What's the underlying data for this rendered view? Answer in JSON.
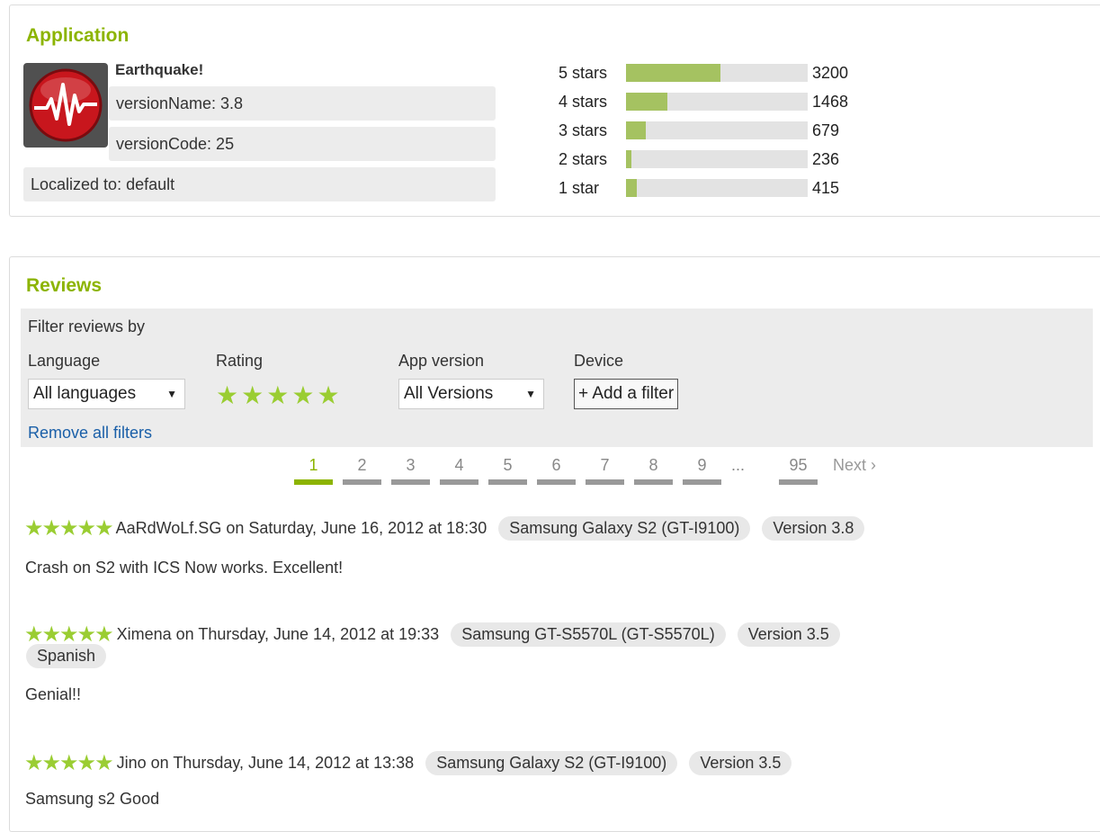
{
  "application": {
    "title": "Application",
    "name": "Earthquake!",
    "version_name": "versionName: 3.8",
    "version_code": "versionCode: 25",
    "localized": "Localized to: default",
    "icon": "earthquake-app-icon"
  },
  "ratings": [
    {
      "label": "5 stars",
      "count": "3200",
      "fraction": 0.52
    },
    {
      "label": "4 stars",
      "count": "1468",
      "fraction": 0.23
    },
    {
      "label": "3 stars",
      "count": "679",
      "fraction": 0.11
    },
    {
      "label": "2 stars",
      "count": "236",
      "fraction": 0.03
    },
    {
      "label": "1 star",
      "count": "415",
      "fraction": 0.06
    }
  ],
  "reviews": {
    "title": "Reviews",
    "filter_title": "Filter reviews by",
    "filters": {
      "language_label": "Language",
      "language_value": "All languages",
      "rating_label": "Rating",
      "app_version_label": "App version",
      "app_version_value": "All Versions",
      "device_label": "Device",
      "device_button": "+ Add a filter",
      "remove_all": "Remove all filters"
    },
    "pagination": {
      "pages": [
        "1",
        "2",
        "3",
        "4",
        "5",
        "6",
        "7",
        "8",
        "9"
      ],
      "ellipsis": "...",
      "last": "95",
      "next": "Next ›",
      "current": "1"
    },
    "items": [
      {
        "stars": "★★★★★",
        "author_line": "AaRdWoLf.SG on Saturday, June 16, 2012 at 18:30",
        "device": "Samsung Galaxy S2 (GT-I9100)",
        "version": "Version 3.8",
        "text": "Crash on S2 with ICS Now works. Excellent!"
      },
      {
        "stars": "★★★★★",
        "author_line": "Ximena on Thursday, June 14, 2012 at 19:33",
        "device": "Samsung GT-S5570L (GT-S5570L)",
        "version": "Version 3.5",
        "language": "Spanish",
        "text": "Genial!!"
      },
      {
        "stars": "★★★★★",
        "author_line": "Jino on Thursday, June 14, 2012 at 13:38",
        "device": "Samsung Galaxy S2 (GT-I9100)",
        "version": "Version 3.5",
        "text": "Samsung s2 Good"
      }
    ]
  },
  "colors": {
    "accent": "#8cb400",
    "bar_fill": "#a5c261",
    "star": "#9acd32",
    "link": "#1a5fa8"
  }
}
